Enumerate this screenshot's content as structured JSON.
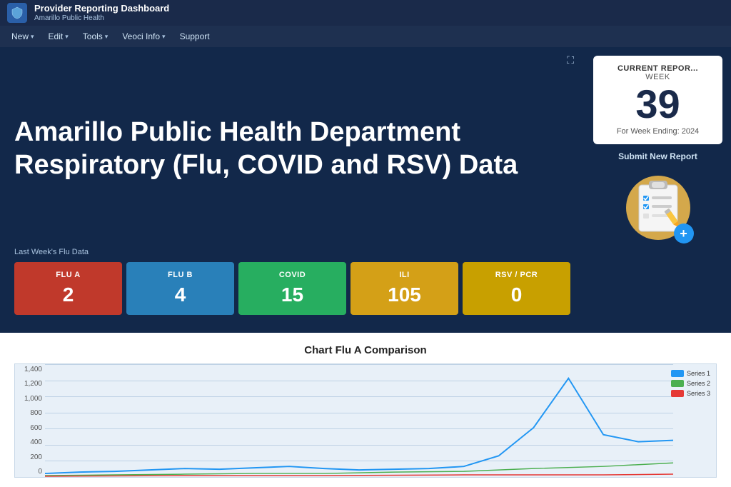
{
  "app": {
    "title": "Provider Reporting Dashboard",
    "subtitle": "Amarillo Public Health"
  },
  "navbar": {
    "items": [
      {
        "label": "New",
        "hasArrow": true
      },
      {
        "label": "Edit",
        "hasArrow": true
      },
      {
        "label": "Tools",
        "hasArrow": true
      },
      {
        "label": "Veoci Info",
        "hasArrow": true
      },
      {
        "label": "Support",
        "hasArrow": false
      }
    ]
  },
  "hero": {
    "title": "Amarillo Public Health Department Respiratory (Flu, COVID and RSV) Data",
    "data_label": "Last Week's Flu Data"
  },
  "week_card": {
    "current_label": "CURRENT REPOR...",
    "week_label": "WEEK",
    "week_number": "39",
    "for_week": "For Week Ending: 2024"
  },
  "submit": {
    "label": "Submit New Report"
  },
  "tiles": [
    {
      "label": "FLU A",
      "value": "2",
      "class": "tile-flu-a"
    },
    {
      "label": "FLU B",
      "value": "4",
      "class": "tile-flu-b"
    },
    {
      "label": "COVID",
      "value": "15",
      "class": "tile-covid"
    },
    {
      "label": "ILI",
      "value": "105",
      "class": "tile-ili"
    },
    {
      "label": "RSV / PCR",
      "value": "0",
      "class": "tile-rsv"
    }
  ],
  "chart": {
    "title": "Chart Flu A Comparison",
    "y_labels": [
      "1,400",
      "1,200",
      "1,000",
      "800",
      "600",
      "400",
      "200",
      "0"
    ],
    "legend": [
      {
        "color": "#2196f3",
        "label": "Series 1"
      },
      {
        "color": "#4caf50",
        "label": "Series 2"
      },
      {
        "color": "#e53935",
        "label": "Series 3"
      }
    ]
  },
  "icons": {
    "logo": "shield",
    "expand": "⛶",
    "plus": "+",
    "nav_arrow": "▾"
  }
}
